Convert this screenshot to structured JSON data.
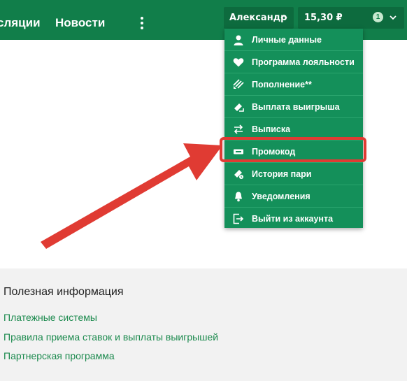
{
  "colors": {
    "nav_bg": "#117e4a",
    "menu_bg": "#14905a",
    "highlight": "#e03b33",
    "link": "#1c8a4e"
  },
  "nav": {
    "items": [
      {
        "label": "сляции"
      },
      {
        "label": "Новости"
      }
    ],
    "more_icon": "more-vertical-icon"
  },
  "user": {
    "name": "Александр",
    "chevron_icon": "chevron-up-icon"
  },
  "balance": {
    "value": "15,30 ₽",
    "badge": "1",
    "chevron_icon": "chevron-down-icon"
  },
  "menu": {
    "items": [
      {
        "label": "Личные данные",
        "icon": "user-icon"
      },
      {
        "label": "Программа лояльности",
        "icon": "heart-icon"
      },
      {
        "label": "Пополнение**",
        "icon": "deposit-icon"
      },
      {
        "label": "Выплата выигрыша",
        "icon": "withdraw-icon"
      },
      {
        "label": "Выписка",
        "icon": "transfer-icon"
      },
      {
        "label": "Промокод",
        "icon": "ticket-icon",
        "highlighted": true
      },
      {
        "label": "История пари",
        "icon": "history-icon"
      },
      {
        "label": "Уведомления",
        "icon": "bell-icon"
      },
      {
        "label": "Выйти из аккаунта",
        "icon": "logout-icon"
      }
    ]
  },
  "footer": {
    "title": "Полезная информация",
    "links": [
      {
        "label": "Платежные системы"
      },
      {
        "label": "Правила приема ставок и выплаты выигрышей"
      },
      {
        "label": "Партнерская программа"
      }
    ]
  }
}
